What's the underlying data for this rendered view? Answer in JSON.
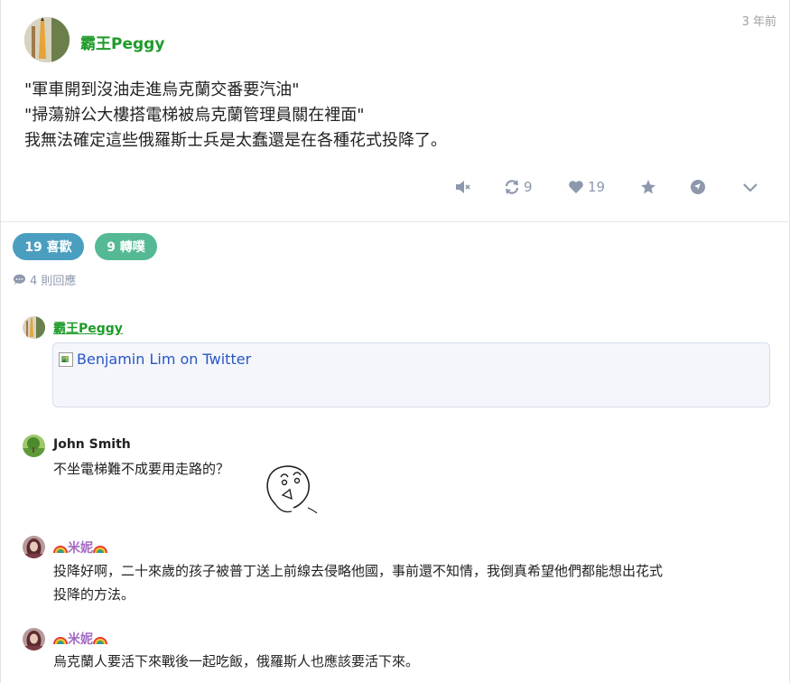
{
  "post": {
    "author": "霸王Peggy",
    "time": "3 年前",
    "lines": [
      "\"軍車開到沒油走進烏克蘭交番要汽油\"",
      "\"掃蕩辦公大樓搭電梯被烏克蘭管理員關在裡面\"",
      "我無法確定這些俄羅斯士兵是太蠢還是在各種花式投降了。"
    ],
    "actions": {
      "mute_icon": "mute-icon",
      "replurk_icon": "replurk-icon",
      "replurk_count": "9",
      "like_icon": "heart-icon",
      "like_count": "19",
      "favorite_icon": "star-icon",
      "share_icon": "share-icon",
      "more_icon": "chevron-down-icon"
    }
  },
  "stats": {
    "likes_label": "19 喜歡",
    "replurks_label": "9 轉噗",
    "responses_label": "4 則回應"
  },
  "responses": [
    {
      "author": "霸王Peggy",
      "card_text": "Benjamin Lim on Twitter"
    },
    {
      "author": "John Smith",
      "text": "不坐電梯難不成要用走路的？"
    },
    {
      "author": "米妮",
      "text_line1": "投降好啊，二十來歲的孩子被普丁送上前線去侵略他國，事前還不知情，我倒真希望他們都能想出花式",
      "text_line2": "投降的方法。"
    },
    {
      "author": "米妮",
      "text": "烏克蘭人要活下來戰後一起吃飯，俄羅斯人也應該要活下來。"
    }
  ],
  "colors": {
    "author_green": "#1e9b2a",
    "minnie_purple": "#a36bc4",
    "likes_pill": "#4a9fc0",
    "replurks_pill": "#55b994",
    "icon_gray": "#8d98ad",
    "link_blue": "#2856c4"
  }
}
